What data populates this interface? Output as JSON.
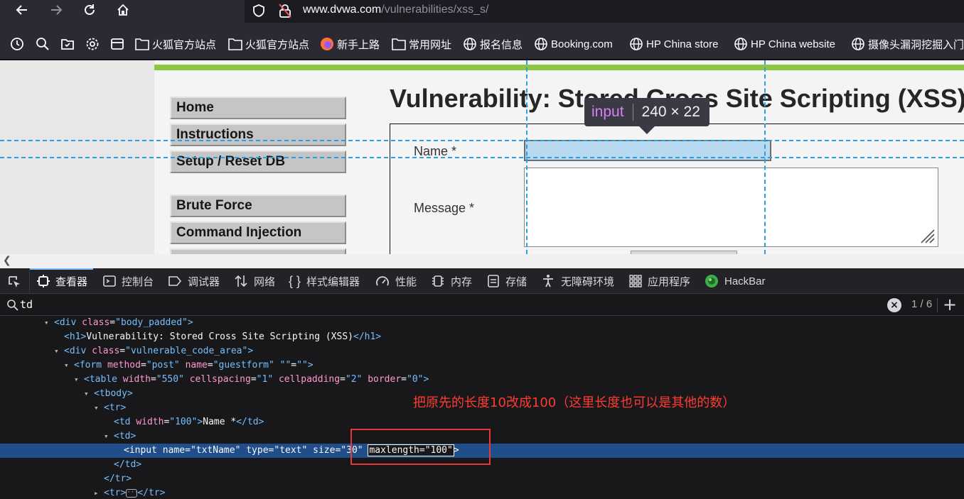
{
  "browser": {
    "url_host": "www.dvwa.com",
    "url_path": "/vulnerabilities/xss_s/",
    "bookmarks": [
      {
        "label": "火狐官方站点",
        "icon": "folder-icon"
      },
      {
        "label": "火狐官方站点",
        "icon": "folder-icon"
      },
      {
        "label": "新手上路",
        "icon": "firefox-icon"
      },
      {
        "label": "常用网址",
        "icon": "folder-icon"
      },
      {
        "label": "报名信息",
        "icon": "globe-icon"
      },
      {
        "label": "Booking.com",
        "icon": "globe-icon"
      },
      {
        "label": "HP China store",
        "icon": "globe-icon"
      },
      {
        "label": "HP China website",
        "icon": "globe-icon"
      },
      {
        "label": "摄像头漏洞挖掘入门",
        "icon": "globe-icon"
      }
    ]
  },
  "page": {
    "menu": [
      "Home",
      "Instructions",
      "Setup / Reset DB",
      "Brute Force",
      "Command Injection"
    ],
    "title": "Vulnerability: Stored Cross Site Scripting (XSS)",
    "form": {
      "name_label": "Name *",
      "message_label": "Message *"
    },
    "tooltip": {
      "tag": "input",
      "dims": "240 × 22"
    }
  },
  "devtools": {
    "tabs": [
      "查看器",
      "控制台",
      "调试器",
      "网络",
      "样式编辑器",
      "性能",
      "内存",
      "存储",
      "无障碍环境",
      "应用程序",
      "HackBar"
    ],
    "search": {
      "query": "td",
      "count": "1 / 6"
    },
    "tree": {
      "l1": {
        "tag": "div",
        "attr": "class",
        "val": "body_padded"
      },
      "l2": {
        "open": "<h1>",
        "text": "Vulnerability: Stored Cross Site Scripting (XSS)",
        "close": "</h1>"
      },
      "l3": {
        "tag": "div",
        "attr": "class",
        "val": "vulnerable_code_area"
      },
      "l4": {
        "tag": "form",
        "a1": "method",
        "v1": "post",
        "a2": "name",
        "v2": "guestform",
        "a3": "",
        "v3": ""
      },
      "l5": {
        "tag": "table",
        "a1": "width",
        "v1": "550",
        "a2": "cellspacing",
        "v2": "1",
        "a3": "cellpadding",
        "v3": "2",
        "a4": "border",
        "v4": "0"
      },
      "l6": "<tbody>",
      "l7": "<tr>",
      "l8": {
        "tag": "td",
        "attr": "width",
        "val": "100",
        "text": "Name *",
        "close": "</td>"
      },
      "l9": "<td>",
      "l10": {
        "tag": "input",
        "a1": "name",
        "v1": "txtName",
        "a2": "type",
        "v2": "text",
        "a3": "size",
        "v3": "30",
        "edit": "maxlength=\"100\""
      },
      "l11": "</td>",
      "l12": "</tr>",
      "l13": {
        "open": "<tr>",
        "close": "</tr>"
      }
    },
    "annotation": "把原先的长度10改成100（这里长度也可以是其他的数）"
  }
}
